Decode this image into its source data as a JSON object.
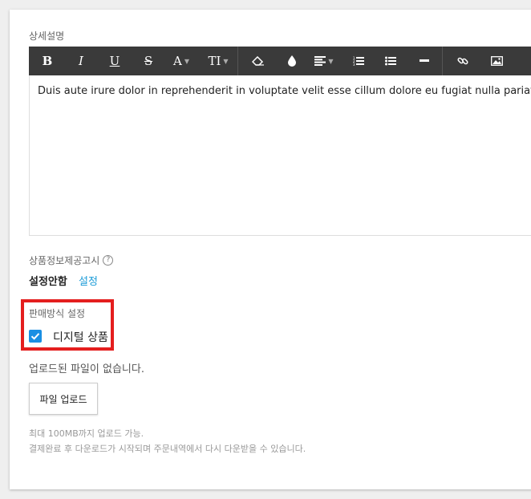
{
  "detail": {
    "label": "상세설명",
    "editor_text": "Duis aute irure dolor in reprehenderit in voluptate velit esse cillum dolore eu fugiat nulla pariatur."
  },
  "toolbar": {
    "bold": "B",
    "italic": "I",
    "underline": "U",
    "strike": "S",
    "font_color": "A",
    "font_size": "TI"
  },
  "notice": {
    "title": "상품정보제공고시",
    "help": "?",
    "value": "설정안함",
    "link": "설정"
  },
  "sale": {
    "title": "판매방식 설정",
    "digital_label": "디지털 상품",
    "digital_checked": true
  },
  "upload": {
    "no_file": "업로드된 파일이 없습니다.",
    "button": "파일 업로드",
    "hint1": "최대 100MB까지 업로드 가능.",
    "hint2": "결제완료 후 다운로드가 시작되며 주문내역에서 다시 다운받을 수 있습니다."
  },
  "colors": {
    "highlight": "#e41e1e",
    "link": "#1a9bd7",
    "checkbox": "#1a8fe3",
    "toolbar_bg": "#3a3a3a"
  }
}
